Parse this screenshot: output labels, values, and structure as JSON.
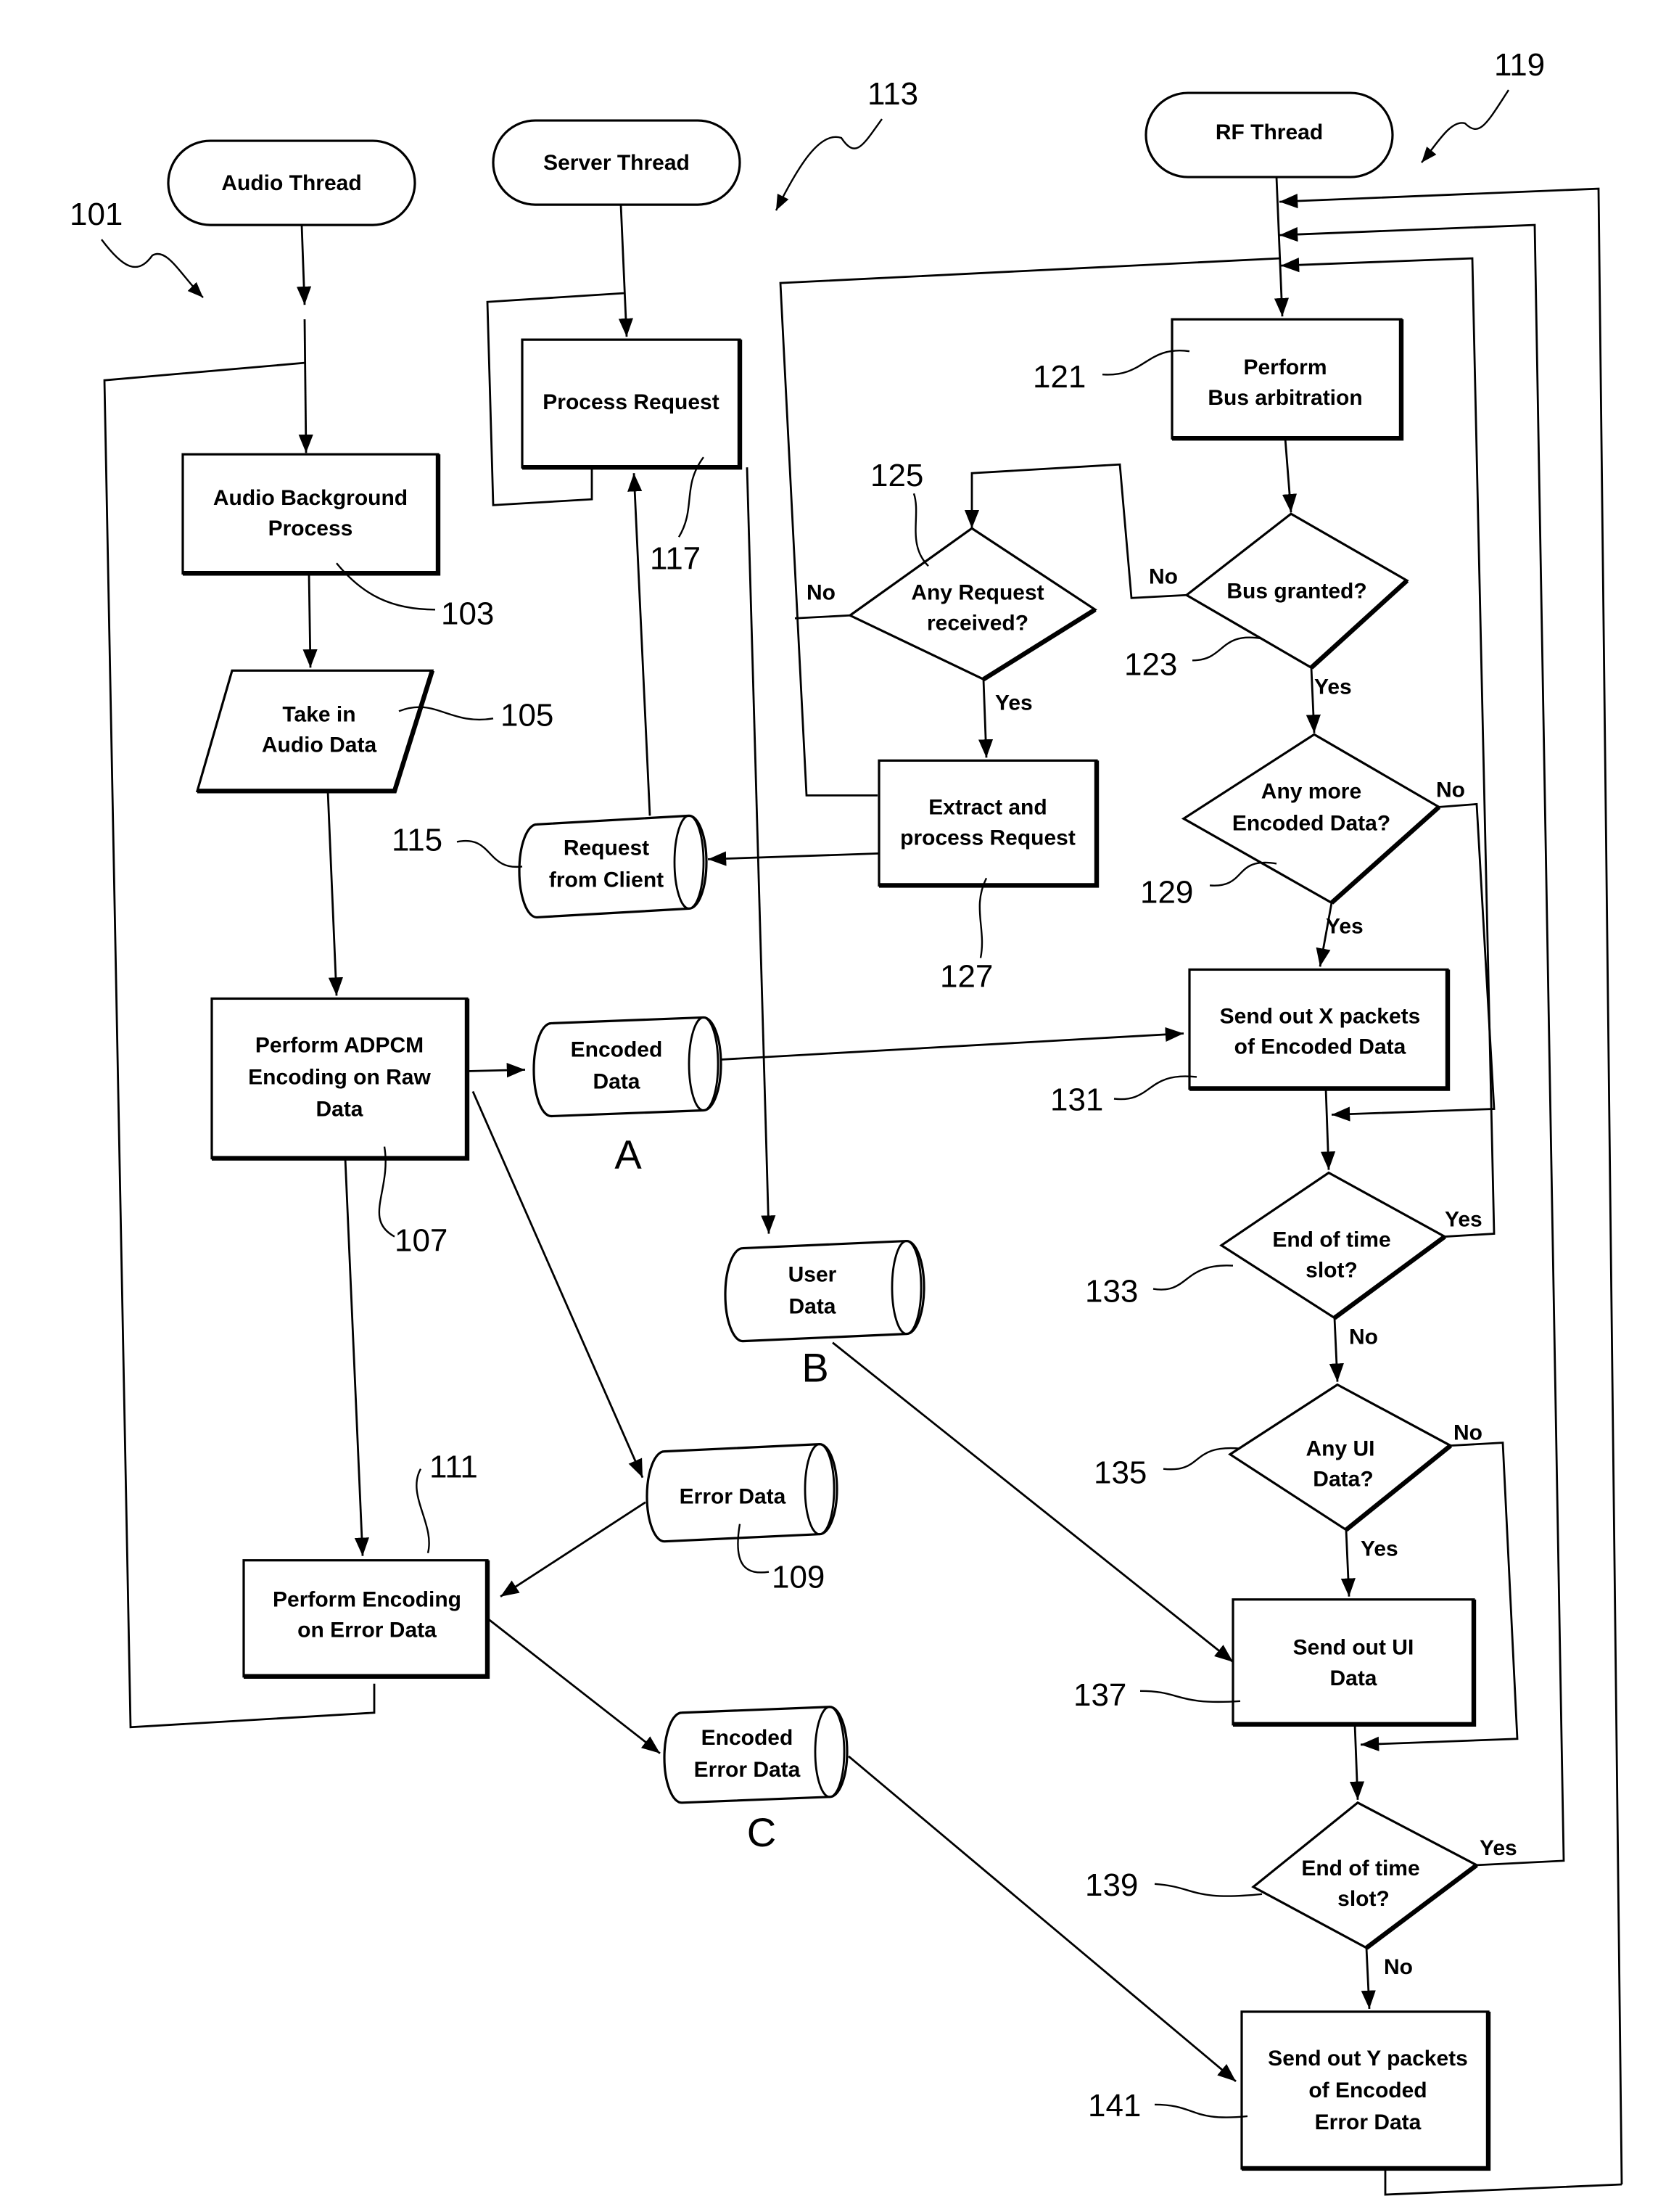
{
  "figure": {
    "type": "patent flowchart",
    "threads": [
      {
        "id": "audio",
        "label": "Audio Thread",
        "ref": "101"
      },
      {
        "id": "server",
        "label": "Server Thread",
        "ref": "113"
      },
      {
        "id": "rf",
        "label": "RF Thread",
        "ref": "119"
      }
    ],
    "nodes": {
      "audio_bg": {
        "lines": [
          "Audio Background",
          "Process"
        ],
        "ref": "103"
      },
      "take_in": {
        "lines": [
          "Take in",
          "Audio Data"
        ],
        "ref": "105"
      },
      "adpcm": {
        "lines": [
          "Perform ADPCM",
          "Encoding on Raw",
          "Data"
        ],
        "ref": "107"
      },
      "error_data": {
        "lines": [
          "Error Data"
        ],
        "ref": "109"
      },
      "encode_error": {
        "lines": [
          "Perform Encoding",
          "on Error Data"
        ],
        "ref": "111"
      },
      "process_request": {
        "lines": [
          "Process Request"
        ],
        "ref": "117"
      },
      "request_client": {
        "lines": [
          "Request",
          "from Client"
        ],
        "ref": "115"
      },
      "encoded_data": {
        "lines": [
          "Encoded",
          "Data"
        ],
        "tag": "A"
      },
      "user_data": {
        "lines": [
          "User",
          "Data"
        ],
        "tag": "B"
      },
      "encoded_error": {
        "lines": [
          "Encoded",
          "Error Data"
        ],
        "tag": "C"
      },
      "bus_arb": {
        "lines": [
          "Perform",
          "Bus arbitration"
        ],
        "ref": "121"
      },
      "bus_granted": {
        "lines": [
          "Bus granted?"
        ],
        "ref": "123"
      },
      "any_request": {
        "lines": [
          "Any Request",
          "received?"
        ],
        "ref": "125"
      },
      "extract": {
        "lines": [
          "Extract  and",
          "process Request"
        ],
        "ref": "127"
      },
      "more_encoded": {
        "lines": [
          "Any more",
          "Encoded Data?"
        ],
        "ref": "129"
      },
      "send_x": {
        "lines": [
          "Send out X packets",
          "of Encoded Data"
        ],
        "ref": "131"
      },
      "end_slot_1": {
        "lines": [
          "End of time",
          "slot?"
        ],
        "ref": "133"
      },
      "any_ui": {
        "lines": [
          "Any UI",
          "Data?"
        ],
        "ref": "135"
      },
      "send_ui": {
        "lines": [
          "Send out UI",
          "Data"
        ],
        "ref": "137"
      },
      "end_slot_2": {
        "lines": [
          "End of time",
          "slot?"
        ],
        "ref": "139"
      },
      "send_y": {
        "lines": [
          "Send out Y packets",
          "of Encoded",
          "Error Data"
        ],
        "ref": "141"
      }
    },
    "branch_labels": {
      "yes": "Yes",
      "no": "No"
    }
  }
}
